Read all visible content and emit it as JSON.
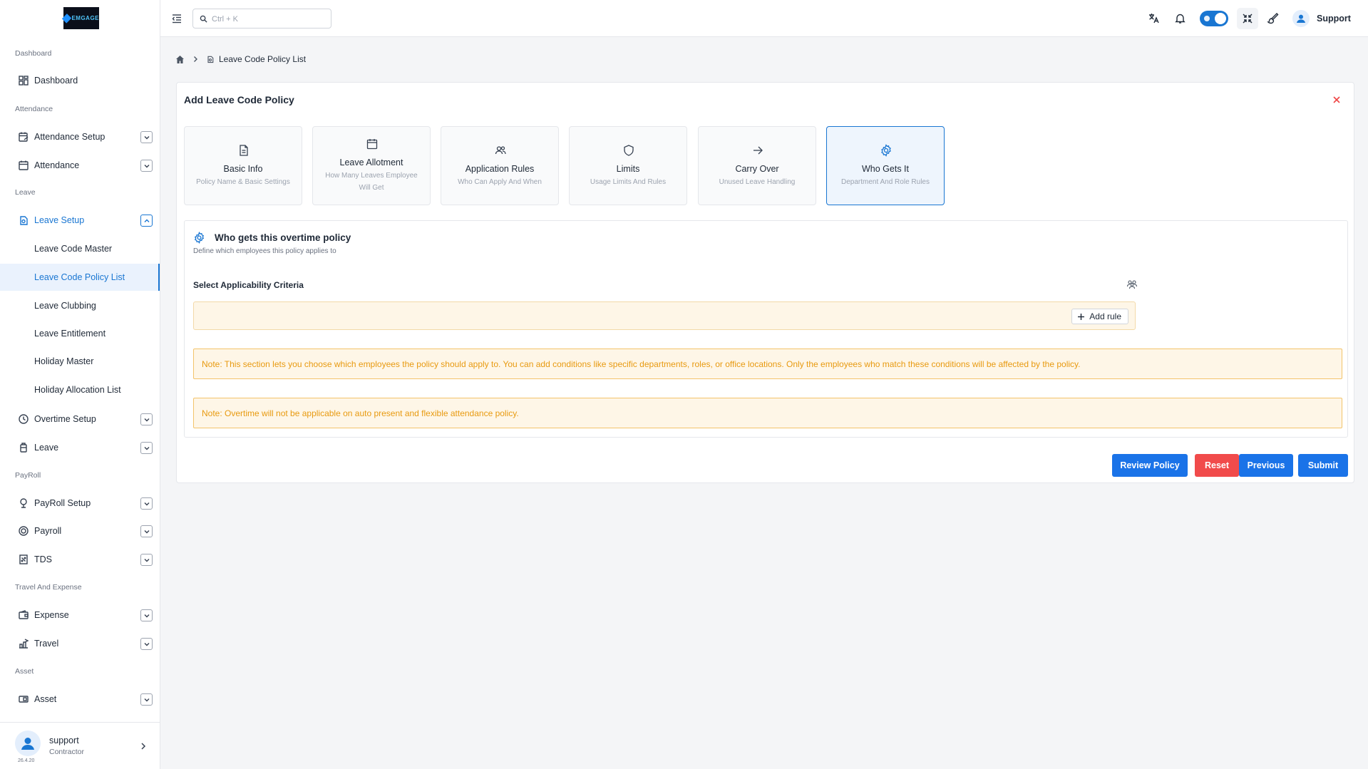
{
  "app": {
    "logo_text": "EMGAGE"
  },
  "sidebar": {
    "sections": {
      "dashboard": "Dashboard",
      "attendance": "Attendance",
      "leave": "Leave",
      "payroll": "PayRoll",
      "travel": "Travel And Expense",
      "asset": "Asset"
    },
    "items": {
      "dashboard": "Dashboard",
      "attendance_setup": "Attendance Setup",
      "attendance": "Attendance",
      "leave_setup": "Leave Setup",
      "overtime_setup": "Overtime Setup",
      "leave": "Leave",
      "payroll_setup": "PayRoll Setup",
      "payroll": "Payroll",
      "tds": "TDS",
      "expense": "Expense",
      "travel": "Travel",
      "asset": "Asset"
    },
    "leave_sub": [
      "Leave Code Master",
      "Leave Code Policy List",
      "Leave Clubbing",
      "Leave Entitlement",
      "Holiday Master",
      "Holiday Allocation List"
    ],
    "user": {
      "name": "support",
      "role": "Contractor",
      "version": "26.4.20"
    }
  },
  "topbar": {
    "search_placeholder": "Ctrl + K",
    "user_name": "Support"
  },
  "breadcrumb": {
    "current": "Leave Code Policy List"
  },
  "form": {
    "title": "Add Leave Code Policy",
    "steps": [
      {
        "title": "Basic Info",
        "subtitle": "Policy Name & Basic Settings",
        "icon": "document-icon"
      },
      {
        "title": "Leave Allotment",
        "subtitle": "How Many Leaves Employee Will Get",
        "icon": "calendar-icon"
      },
      {
        "title": "Application Rules",
        "subtitle": "Who Can Apply And When",
        "icon": "users-icon"
      },
      {
        "title": "Limits",
        "subtitle": "Usage Limits And Rules",
        "icon": "shield-icon"
      },
      {
        "title": "Carry Over",
        "subtitle": "Unused Leave Handling",
        "icon": "arrow-right-icon"
      },
      {
        "title": "Who Gets It",
        "subtitle": "Department And Role Rules",
        "icon": "gear-icon"
      }
    ],
    "active_step": 5,
    "section": {
      "heading": "Who gets this overtime policy",
      "subheading": "Define which employees this policy applies to",
      "criteria_label": "Select Applicability Criteria",
      "add_rule_label": "Add rule",
      "note1": "Note: This section lets you choose which employees the policy should apply to. You can add conditions like specific departments, roles, or office locations. Only the employees who match these conditions will be affected by the policy.",
      "note2": "Note: Overtime will not be applicable on auto present and flexible attendance policy."
    },
    "buttons": {
      "review": "Review Policy",
      "reset": "Reset",
      "previous": "Previous",
      "submit": "Submit"
    }
  },
  "colors": {
    "accent": "#1976d2",
    "danger": "#f14b4b",
    "note_text": "#e89a10",
    "note_bg": "#fef6e7"
  }
}
